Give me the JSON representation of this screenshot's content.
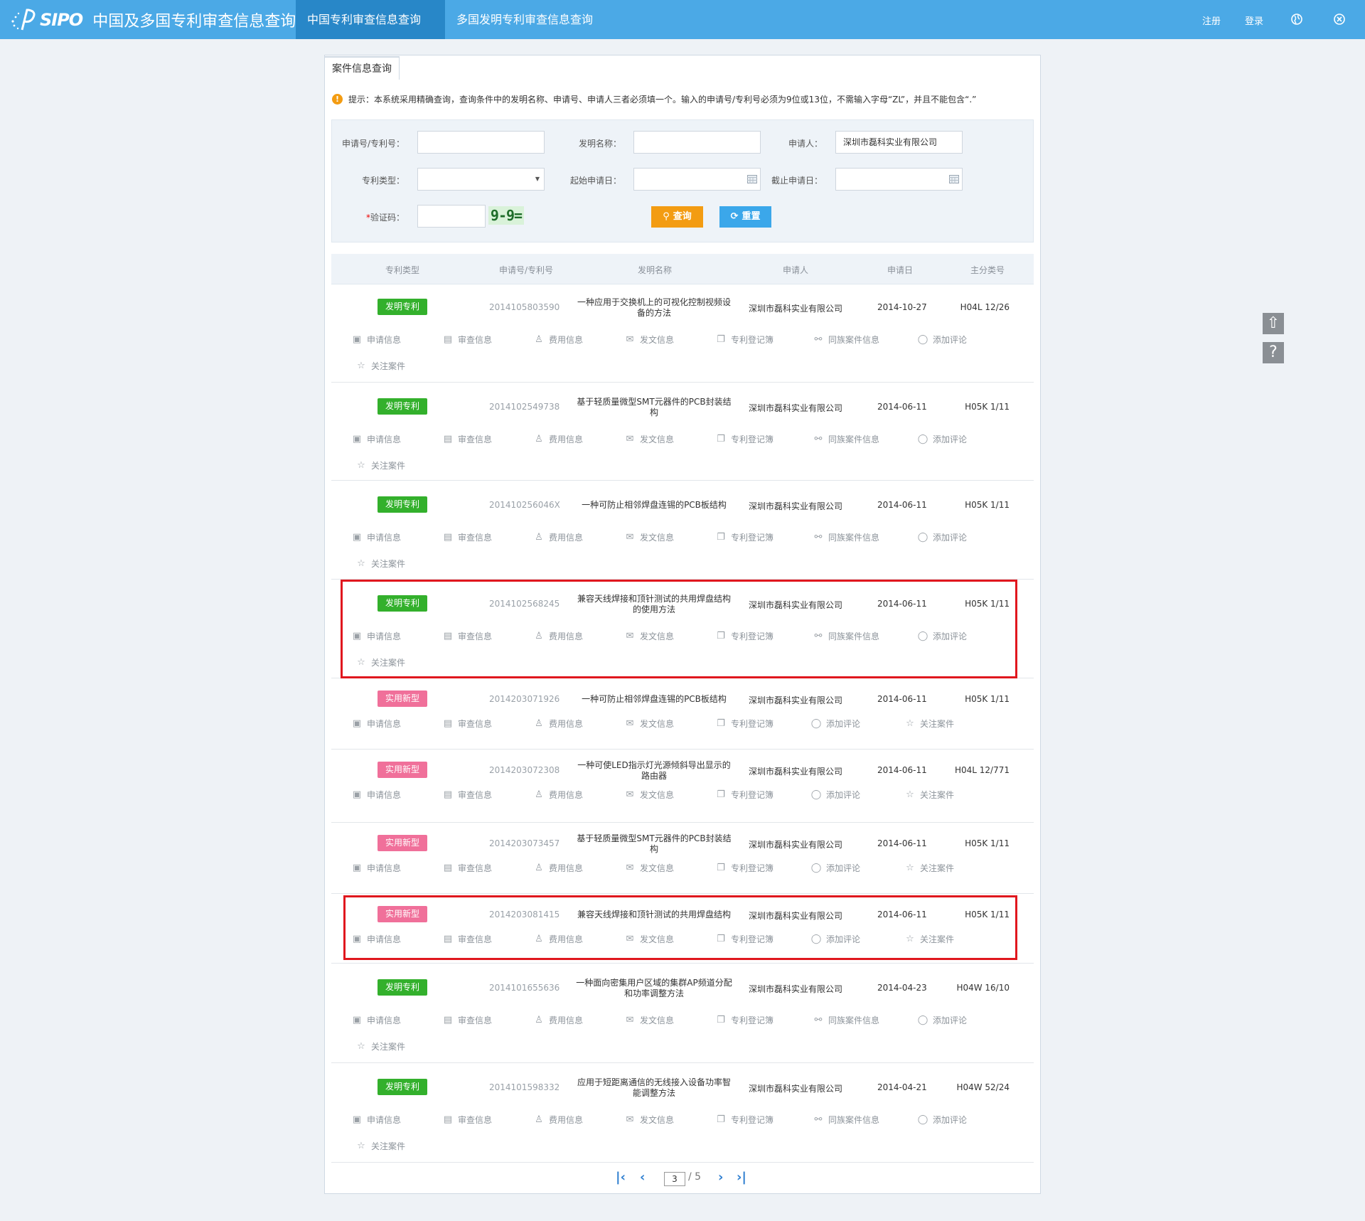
{
  "header": {
    "logo_text": "SIPO",
    "site_title": "中国及多国专利审查信息查询",
    "tabs": [
      {
        "label": "中国专利审查信息查询",
        "active": true
      },
      {
        "label": "多国发明专利审查信息查询",
        "active": false
      }
    ],
    "register": "注册",
    "login": "登录"
  },
  "panel": {
    "tab_label": "案件信息查询",
    "hint": "提示：本系统采用精确查询，查询条件中的发明名称、申请号、申请人三者必须填一个。输入的申请号/专利号必须为9位或13位，不需输入字母“ZL”，并且不能包含“.”"
  },
  "form": {
    "app_no_label": "申请号/专利号：",
    "app_no_value": "",
    "title_label": "发明名称：",
    "title_value": "",
    "applicant_label": "申请人：",
    "applicant_value": "深圳市磊科实业有限公司",
    "type_label": "专利类型：",
    "type_value": "",
    "start_date_label": "起始申请日：",
    "end_date_label": "截止申请日：",
    "captcha_label": "验证码：",
    "captcha_required": "*",
    "captcha_text": "9-9=",
    "search_button": "查询",
    "reset_button": "重置"
  },
  "table": {
    "headers": [
      "专利类型",
      "申请号/专利号",
      "发明名称",
      "申请人",
      "申请日",
      "主分类号"
    ],
    "rows": [
      {
        "type": "发明专利",
        "kind": "invention",
        "no": "2014105803590",
        "name": "一种应用于交换机上的可视化控制视频设备的方法",
        "applicant": "深圳市磊科实业有限公司",
        "date": "2014-10-27",
        "ipc": "H04L 12/26"
      },
      {
        "type": "发明专利",
        "kind": "invention",
        "no": "2014102549738",
        "name": "基于轻质量微型SMT元器件的PCB封装结构",
        "applicant": "深圳市磊科实业有限公司",
        "date": "2014-06-11",
        "ipc": "H05K 1/11"
      },
      {
        "type": "发明专利",
        "kind": "invention",
        "no": "201410256046X",
        "name": "一种可防止相邻焊盘连锡的PCB板结构",
        "applicant": "深圳市磊科实业有限公司",
        "date": "2014-06-11",
        "ipc": "H05K 1/11"
      },
      {
        "type": "发明专利",
        "kind": "invention",
        "no": "2014102568245",
        "name": "兼容天线焊接和顶针测试的共用焊盘结构的使用方法",
        "applicant": "深圳市磊科实业有限公司",
        "date": "2014-06-11",
        "ipc": "H05K 1/11"
      },
      {
        "type": "实用新型",
        "kind": "utility",
        "no": "2014203071926",
        "name": "一种可防止相邻焊盘连锡的PCB板结构",
        "applicant": "深圳市磊科实业有限公司",
        "date": "2014-06-11",
        "ipc": "H05K 1/11"
      },
      {
        "type": "实用新型",
        "kind": "utility",
        "no": "2014203072308",
        "name": "一种可使LED指示灯光源倾斜导出显示的路由器",
        "applicant": "深圳市磊科实业有限公司",
        "date": "2014-06-11",
        "ipc": "H04L 12/771"
      },
      {
        "type": "实用新型",
        "kind": "utility",
        "no": "2014203073457",
        "name": "基于轻质量微型SMT元器件的PCB封装结构",
        "applicant": "深圳市磊科实业有限公司",
        "date": "2014-06-11",
        "ipc": "H05K 1/11"
      },
      {
        "type": "实用新型",
        "kind": "utility",
        "no": "2014203081415",
        "name": "兼容天线焊接和顶针测试的共用焊盘结构",
        "applicant": "深圳市磊科实业有限公司",
        "date": "2014-06-11",
        "ipc": "H05K 1/11"
      },
      {
        "type": "发明专利",
        "kind": "invention",
        "no": "2014101655636",
        "name": "一种面向密集用户区域的集群AP频道分配和功率调整方法",
        "applicant": "深圳市磊科实业有限公司",
        "date": "2014-04-23",
        "ipc": "H04W 16/10"
      },
      {
        "type": "发明专利",
        "kind": "invention",
        "no": "2014101598332",
        "name": "应用于短距离通信的无线接入设备功率智能调整方法",
        "applicant": "深圳市磊科实业有限公司",
        "date": "2014-04-21",
        "ipc": "H04W 52/24"
      }
    ],
    "actions_invention": [
      "申请信息",
      "审查信息",
      "费用信息",
      "发文信息",
      "专利登记簿",
      "同族案件信息",
      "添加评论",
      "关注案件"
    ],
    "actions_utility": [
      "申请信息",
      "审查信息",
      "费用信息",
      "发文信息",
      "专利登记簿",
      "添加评论",
      "关注案件"
    ],
    "action_icons": {
      "申请信息": "application-info-icon",
      "审查信息": "examination-info-icon",
      "费用信息": "fee-info-icon",
      "发文信息": "notice-info-icon",
      "专利登记簿": "register-book-icon",
      "同族案件信息": "family-cases-icon",
      "添加评论": "comment-icon",
      "关注案件": "star-icon"
    },
    "highlighted_rows": [
      3,
      7
    ]
  },
  "pager": {
    "current": "3",
    "total": "/ 5"
  },
  "colors": {
    "topbar": "#4ba9e6",
    "active_tab": "#2887c8",
    "invention_badge": "#33b02c",
    "utility_badge": "#f0709a",
    "search_button": "#f39c12",
    "reset_button": "#3ba7ea",
    "highlight": "#e0171e"
  }
}
